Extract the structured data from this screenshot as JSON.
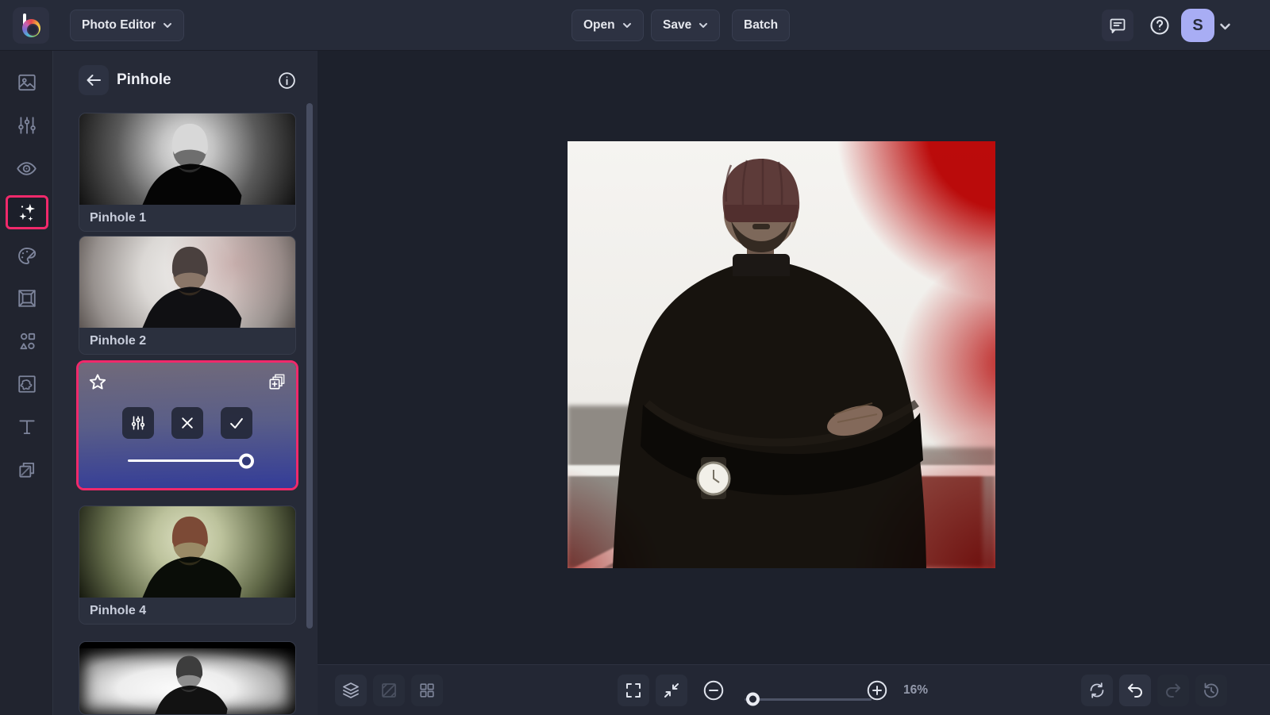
{
  "colors": {
    "accent_pink": "#f0296b",
    "avatar_bg": "#a8adf4",
    "canvas_red": "#c30b0b",
    "topbar_bg": "#262b39",
    "panel_bg": "#262a37",
    "canvas_bg": "#1d212c"
  },
  "topbar": {
    "app_menu_label": "Photo Editor",
    "open_label": "Open",
    "save_label": "Save",
    "batch_label": "Batch",
    "user_initial": "S",
    "icons": [
      "befunky-logo",
      "feedback-icon",
      "help-icon",
      "account-chevron-icon"
    ]
  },
  "sidebar": {
    "active_item": "effects",
    "items": [
      {
        "icon": "photo-icon"
      },
      {
        "icon": "adjust-sliders-icon"
      },
      {
        "icon": "eye-icon"
      },
      {
        "icon": "sparkles-icon",
        "active": true
      },
      {
        "icon": "palette-icon"
      },
      {
        "icon": "frame-icon"
      },
      {
        "icon": "shapes-icon"
      },
      {
        "icon": "texture-icon"
      },
      {
        "icon": "text-icon"
      },
      {
        "icon": "layers-copy-icon"
      }
    ]
  },
  "panel": {
    "title": "Pinhole",
    "header_icons": [
      "back-arrow-icon",
      "info-icon"
    ],
    "items": [
      {
        "label": "Pinhole 1",
        "state": "default"
      },
      {
        "label": "Pinhole 2",
        "state": "default"
      },
      {
        "label": "",
        "state": "selected",
        "amount_percent": 100,
        "controls": [
          "favorite-star-icon",
          "duplicate-icon",
          "settings-sliders-icon",
          "cancel-icon",
          "apply-icon",
          "amount-slider"
        ]
      },
      {
        "label": "Pinhole 4",
        "state": "default"
      },
      {
        "label": "",
        "state": "partially-visible"
      }
    ]
  },
  "bottombar": {
    "zoom_label": "16%",
    "zoom_slider_percent": 4,
    "left_icons": [
      "layers-icon",
      "compare-icon",
      "grid-icon"
    ],
    "center_icons": [
      "fullscreen-icon",
      "fit-screen-icon",
      "zoom-out-icon",
      "zoom-in-icon"
    ],
    "right_icons": [
      "reset-icon",
      "undo-icon",
      "redo-icon",
      "history-icon"
    ],
    "disabled_icons": [
      "compare-icon",
      "redo-icon"
    ]
  }
}
